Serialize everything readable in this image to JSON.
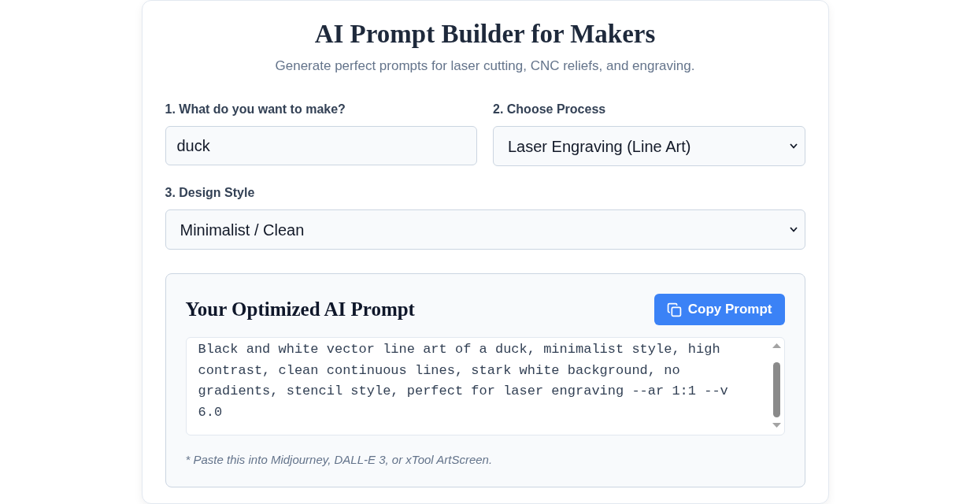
{
  "header": {
    "title": "AI Prompt Builder for Makers",
    "subtitle": "Generate perfect prompts for laser cutting, CNC reliefs, and engraving."
  },
  "fields": [
    {
      "kind": "text",
      "label": "1. What do you want to make?",
      "value": "duck"
    },
    {
      "kind": "select",
      "label": "2. Choose Process",
      "value": "Laser Engraving (Line Art)"
    },
    {
      "kind": "select",
      "label": "3. Design Style",
      "value": "Minimalist / Clean"
    }
  ],
  "output": {
    "title": "Your Optimized AI Prompt",
    "copy_button": "Copy Prompt",
    "prompt": "Black and white vector line art of a duck, minimalist style, high contrast, clean continuous lines, stark white background, no gradients, stencil style, perfect for laser engraving --ar 1:1 --v 6.0",
    "note": "* Paste this into Midjourney, DALL-E 3, or xTool ArtScreen."
  }
}
